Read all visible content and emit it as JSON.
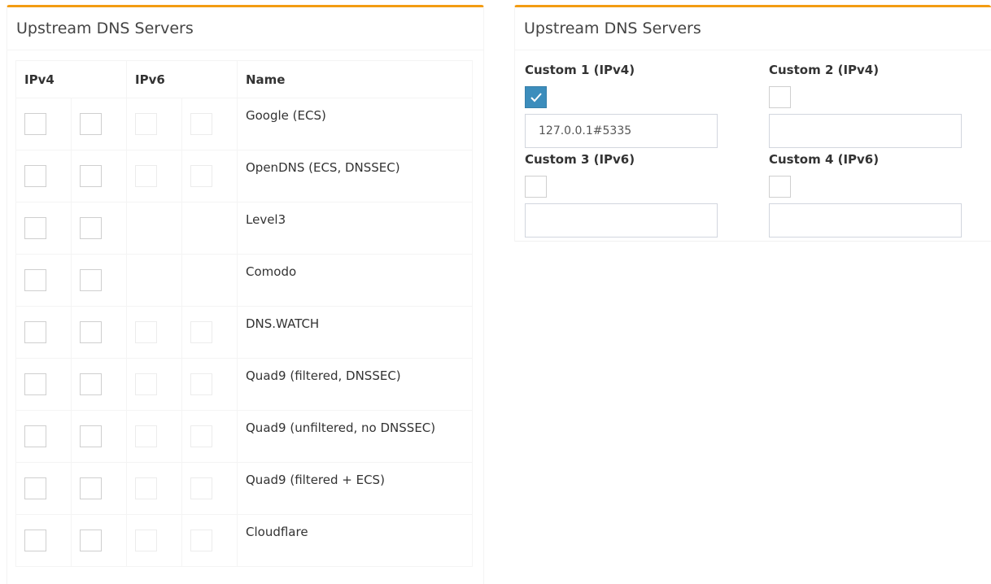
{
  "left_panel": {
    "title": "Upstream DNS Servers",
    "headers": {
      "ipv4": "IPv4",
      "ipv6": "IPv6",
      "name": "Name"
    },
    "rows": [
      {
        "name": "Google (ECS)",
        "has_ipv6": true
      },
      {
        "name": "OpenDNS (ECS, DNSSEC)",
        "has_ipv6": true
      },
      {
        "name": "Level3",
        "has_ipv6": false
      },
      {
        "name": "Comodo",
        "has_ipv6": false
      },
      {
        "name": "DNS.WATCH",
        "has_ipv6": true
      },
      {
        "name": "Quad9 (filtered, DNSSEC)",
        "has_ipv6": true
      },
      {
        "name": "Quad9 (unfiltered, no DNSSEC)",
        "has_ipv6": true
      },
      {
        "name": "Quad9 (filtered + ECS)",
        "has_ipv6": true
      },
      {
        "name": "Cloudflare",
        "has_ipv6": true
      }
    ]
  },
  "right_panel": {
    "title": "Upstream DNS Servers",
    "custom": [
      {
        "label": "Custom 1 (IPv4)",
        "checked": true,
        "value": "127.0.0.1#5335"
      },
      {
        "label": "Custom 2 (IPv4)",
        "checked": false,
        "value": ""
      },
      {
        "label": "Custom 3 (IPv6)",
        "checked": false,
        "value": ""
      },
      {
        "label": "Custom 4 (IPv6)",
        "checked": false,
        "value": ""
      }
    ]
  },
  "colors": {
    "box_accent": "#f39c12",
    "checkbox_checked": "#3c8dbc"
  },
  "icons": {
    "checked_mark": "check-icon"
  }
}
